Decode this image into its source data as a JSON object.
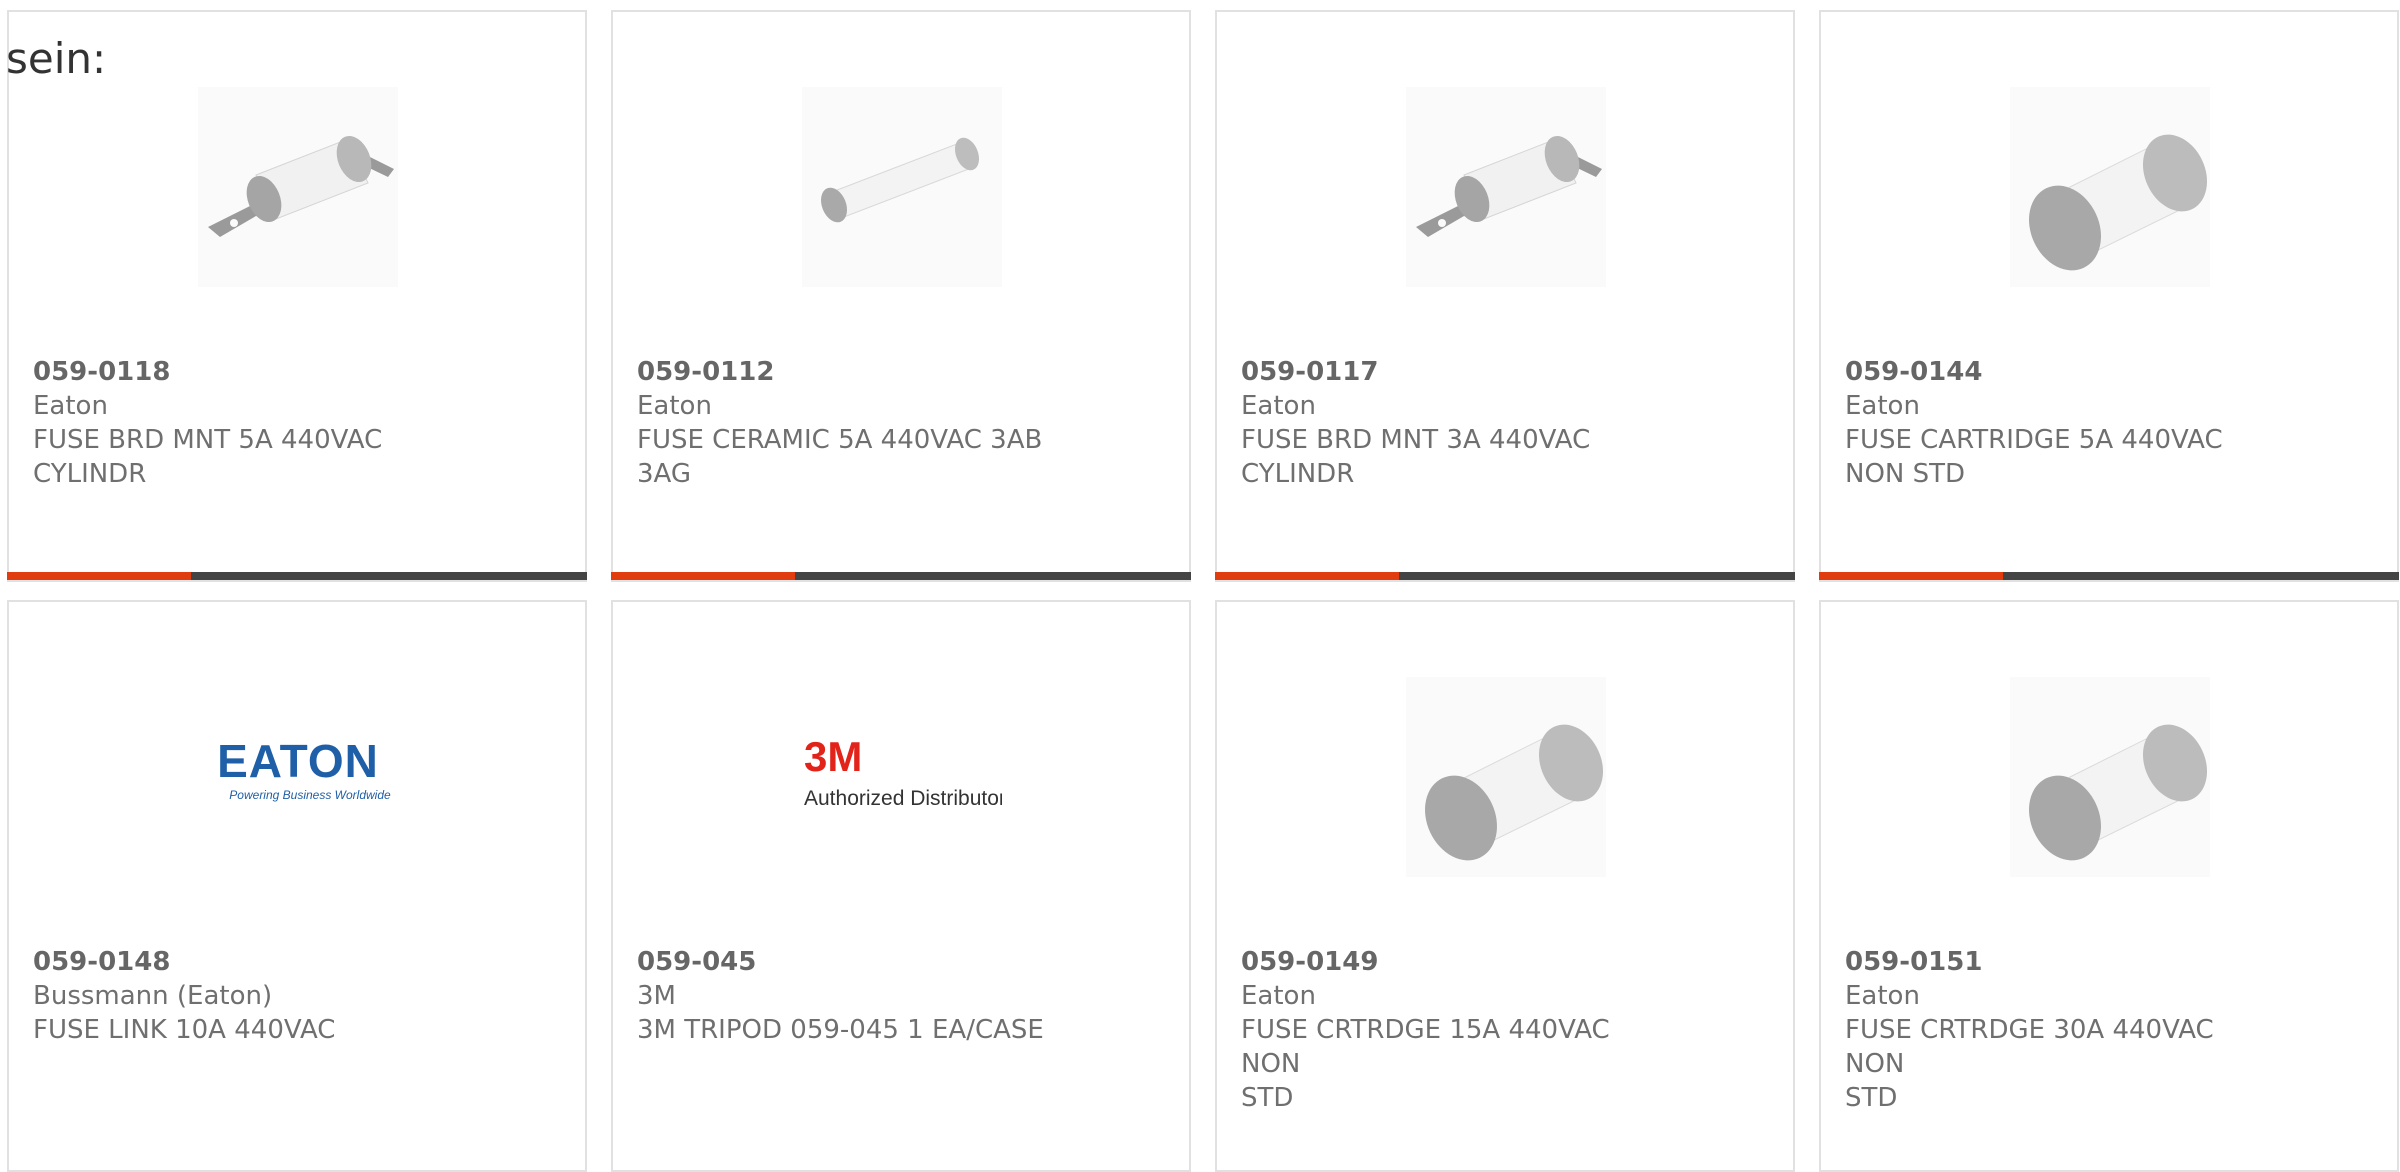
{
  "intro_text": "sein:",
  "accent_color": "#e03c10",
  "products": [
    {
      "part_number": "059-0118",
      "brand": "Eaton",
      "desc_line1": "FUSE BRD MNT 5A 440VAC",
      "desc_line2": "CYLINDR",
      "image": "bracket-fuse-icon"
    },
    {
      "part_number": "059-0112",
      "brand": "Eaton",
      "desc_line1": "FUSE CERAMIC 5A 440VAC 3AB",
      "desc_line2": "3AG",
      "image": "ceramic-fuse-icon"
    },
    {
      "part_number": "059-0117",
      "brand": "Eaton",
      "desc_line1": "FUSE BRD MNT 3A 440VAC",
      "desc_line2": "CYLINDR",
      "image": "bracket-fuse-icon"
    },
    {
      "part_number": "059-0144",
      "brand": "Eaton",
      "desc_line1": "FUSE CARTRIDGE 5A 440VAC",
      "desc_line2": "NON STD",
      "image": "cartridge-fuse-icon"
    },
    {
      "part_number": "059-0148",
      "brand": "Bussmann (Eaton)",
      "desc_line1": "FUSE LINK 10A 440VAC",
      "desc_line2": "",
      "image": "eaton-logo",
      "logo": {
        "wordmark": "EATON",
        "tagline": "Powering Business Worldwide",
        "color": "#1f5fa8"
      }
    },
    {
      "part_number": "059-045",
      "brand": "3M",
      "desc_line1": "3M TRIPOD 059-045 1 EA/CASE",
      "desc_line2": "",
      "image": "3m-logo",
      "logo": {
        "wordmark": "3M",
        "tagline": "Authorized Distributor",
        "color": "#e2231a"
      }
    },
    {
      "part_number": "059-0149",
      "brand": "Eaton",
      "desc_line1": "FUSE CRTRDGE 15A 440VAC NON",
      "desc_line2": "STD",
      "image": "cartridge-fuse-icon"
    },
    {
      "part_number": "059-0151",
      "brand": "Eaton",
      "desc_line1": "FUSE CRTRDGE 30A 440VAC NON",
      "desc_line2": "STD",
      "image": "cartridge-fuse-icon"
    }
  ]
}
